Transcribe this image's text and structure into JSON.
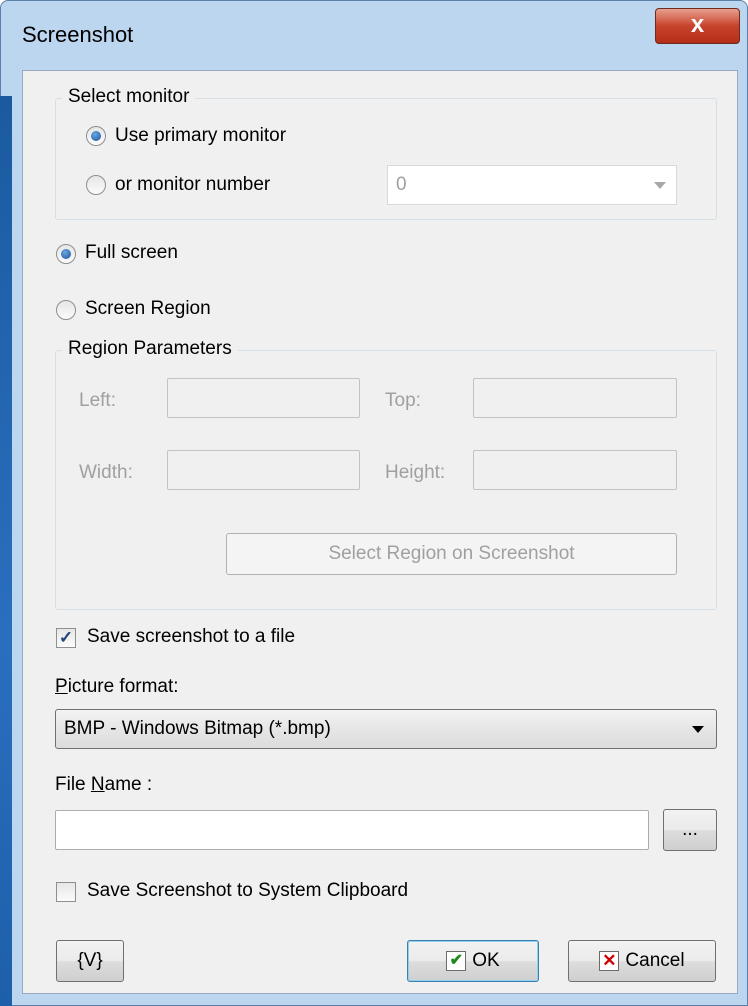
{
  "window": {
    "title": "Screenshot",
    "close_glyph": "x"
  },
  "select_monitor": {
    "legend": "Select monitor",
    "use_primary_label": "Use primary monitor",
    "monitor_number_label": "or monitor number",
    "monitor_number_value": "0"
  },
  "capture_mode": {
    "full_screen_label": "Full screen",
    "screen_region_label": "Screen Region"
  },
  "region": {
    "legend": "Region Parameters",
    "left_label": "Left:",
    "top_label": "Top:",
    "width_label": "Width:",
    "height_label": "Height:",
    "select_button": "Select Region on Screenshot"
  },
  "save_file": {
    "checkbox_label": "Save screenshot to a file",
    "checked": true,
    "format_label_first": "P",
    "format_label_rest": "icture format:",
    "format_value": "BMP - Windows Bitmap (*.bmp)",
    "filename_label_pre": "File ",
    "filename_label_u": "N",
    "filename_label_post": "ame :",
    "filename_value": "",
    "browse_label": "..."
  },
  "clipboard": {
    "checkbox_label": "Save Screenshot to System Clipboard",
    "checked": false
  },
  "footer": {
    "variables_button": "{V}",
    "ok_button": "OK",
    "cancel_button": "Cancel",
    "ok_glyph": "✔",
    "cancel_glyph": "✕"
  }
}
